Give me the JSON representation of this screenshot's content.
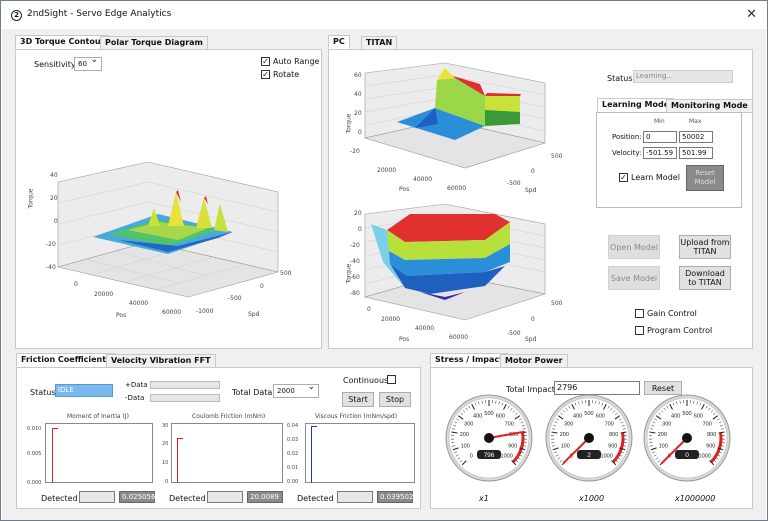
{
  "window": {
    "title": "2ndSight - Servo Edge Analytics",
    "close_label": "✕",
    "app_icon": "2"
  },
  "left_top": {
    "tabs": [
      "3D Torque Contour",
      "Polar Torque Diagram"
    ],
    "sensitivity_label": "Sensitivity",
    "sensitivity_value": "60",
    "auto_range_label": "Auto Range",
    "rotate_label": "Rotate",
    "z_ticks": [
      "40",
      "20",
      "0",
      "-20",
      "-40"
    ],
    "z_label": "Torque",
    "x_ticks": [
      "0",
      "20000",
      "40000",
      "60000"
    ],
    "x_label": "Pos",
    "y_ticks": [
      "500",
      "0",
      "-500",
      "-1000"
    ],
    "y_label": "Spd"
  },
  "right_top": {
    "tabs": [
      "PC",
      "TITAN"
    ],
    "chart1": {
      "z_ticks": [
        "60",
        "40",
        "20",
        "0",
        "-20"
      ],
      "x_ticks": [
        "20000",
        "40000",
        "60000"
      ],
      "y_ticks": [
        "500",
        "0",
        "-500"
      ],
      "z_label": "Torque",
      "x_label": "Pos",
      "y_label": "Spd"
    },
    "chart2": {
      "z_ticks": [
        "20",
        "0",
        "-20",
        "-40",
        "-60",
        "-80"
      ],
      "x_ticks": [
        "0",
        "20000",
        "40000",
        "60000"
      ],
      "y_ticks": [
        "500",
        "0",
        "-500"
      ],
      "z_label": "Torque",
      "x_label": "Pos",
      "y_label": "Spd"
    },
    "status_label": "Status:",
    "status_value": "Learning...",
    "mode_tabs": [
      "Learning Mode",
      "Monitoring Mode"
    ],
    "min_label": "Min",
    "max_label": "Max",
    "position_label": "Position:",
    "position_min": "0",
    "position_max": "50002",
    "velocity_label": "Velocity:",
    "velocity_min": "-501.59",
    "velocity_max": "501.99",
    "learn_model_label": "Learn Model",
    "reset_model_label": "Reset Model",
    "open_model_label": "Open Model",
    "upload_label": "Upload from TITAN",
    "save_model_label": "Save Model",
    "download_label": "Download to TITAN",
    "gain_control_label": "Gain Control",
    "program_control_label": "Program Control"
  },
  "bottom_left": {
    "tabs": [
      "Friction Coefficients",
      "Velocity Vibration FFT"
    ],
    "status_label": "Status",
    "status_value": "IDLE",
    "plus_data_label": "+Data",
    "minus_data_label": "-Data",
    "total_data_label": "Total Data:",
    "total_data_value": "2000",
    "continuous_label": "Continuous",
    "start_label": "Start",
    "stop_label": "Stop",
    "charts": [
      {
        "title": "Moment of Inertia (J)",
        "y_ticks": [
          "0.010",
          "0.005",
          "0.000"
        ],
        "detected_label": "Detected",
        "detected_value": "0.025056",
        "color": "#e02020"
      },
      {
        "title": "Coulomb Friction (mNm)",
        "y_ticks": [
          "30",
          "20",
          "10",
          "0"
        ],
        "detected_label": "Detected",
        "detected_value": "20.0089",
        "color": "#e02020"
      },
      {
        "title": "Viscous Friction (mNm/spd)",
        "y_ticks": [
          "0.04",
          "0.03",
          "0.02",
          "0.01",
          "0.00"
        ],
        "detected_label": "Detected",
        "detected_value": "0.039502",
        "color": "#1a3ab0"
      }
    ]
  },
  "bottom_right": {
    "tabs": [
      "Stress / Impact",
      "Motor Power"
    ],
    "total_impact_label": "Total Impact:",
    "total_impact_value": "2796",
    "reset_label": "Reset",
    "gauges": [
      {
        "value": "796",
        "multiplier": "x1",
        "ticks": [
          "0",
          "100",
          "200",
          "300",
          "400",
          "500",
          "600",
          "700",
          "800",
          "900",
          "1000"
        ],
        "needle_fraction": 0.796
      },
      {
        "value": "2",
        "multiplier": "x1000",
        "ticks": [
          "0",
          "100",
          "200",
          "300",
          "400",
          "500",
          "600",
          "700",
          "800",
          "900",
          "1000"
        ],
        "needle_fraction": 0.002
      },
      {
        "value": "0",
        "multiplier": "x1000000",
        "ticks": [
          "0",
          "100",
          "200",
          "300",
          "400",
          "500",
          "600",
          "700",
          "800",
          "900",
          "1000"
        ],
        "needle_fraction": 0.0
      }
    ]
  }
}
